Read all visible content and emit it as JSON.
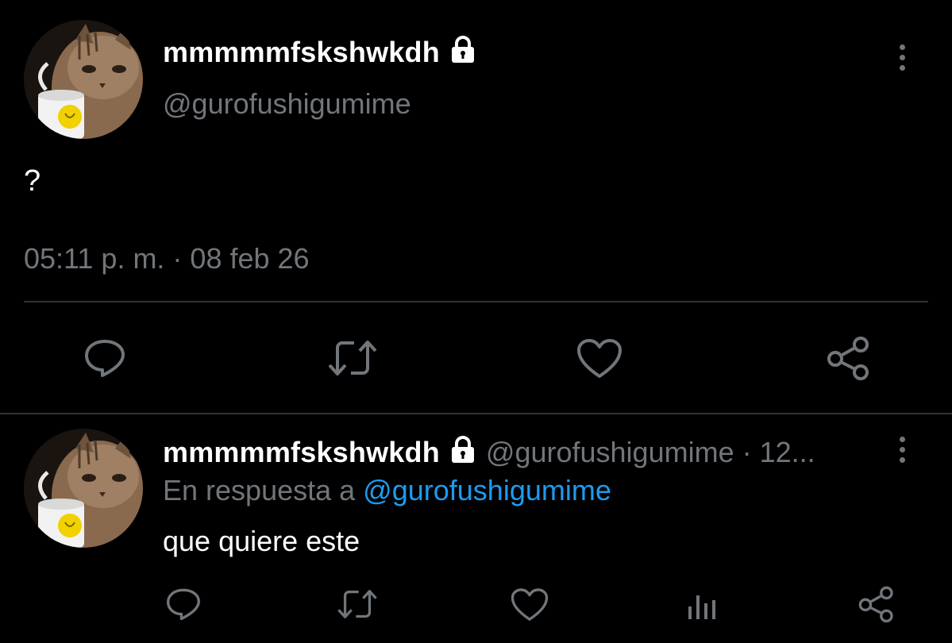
{
  "main_tweet": {
    "display_name": "mmmmmfskshwkdh",
    "handle": "@gurofushigumime",
    "text": "?",
    "timestamp": "05:11 p. m. · 08 feb 26",
    "protected_icon": "lock-icon",
    "actions": [
      {
        "icon": "reply-icon"
      },
      {
        "icon": "retweet-icon"
      },
      {
        "icon": "like-icon"
      },
      {
        "icon": "share-icon"
      }
    ]
  },
  "reply_tweet": {
    "display_name": "mmmmmfskshwkdh",
    "handle_time": "@gurofushigumime · 12...",
    "reply_prefix": "En respuesta a ",
    "reply_to": "@gurofushigumime",
    "text": "que quiere este",
    "actions": [
      {
        "icon": "reply-icon"
      },
      {
        "icon": "retweet-icon"
      },
      {
        "icon": "like-icon"
      },
      {
        "icon": "views-icon"
      },
      {
        "icon": "share-icon"
      }
    ]
  },
  "colors": {
    "background": "#000000",
    "muted": "#71767b",
    "link": "#1d9bf0",
    "text": "#ffffff",
    "divider": "#2f3336"
  }
}
